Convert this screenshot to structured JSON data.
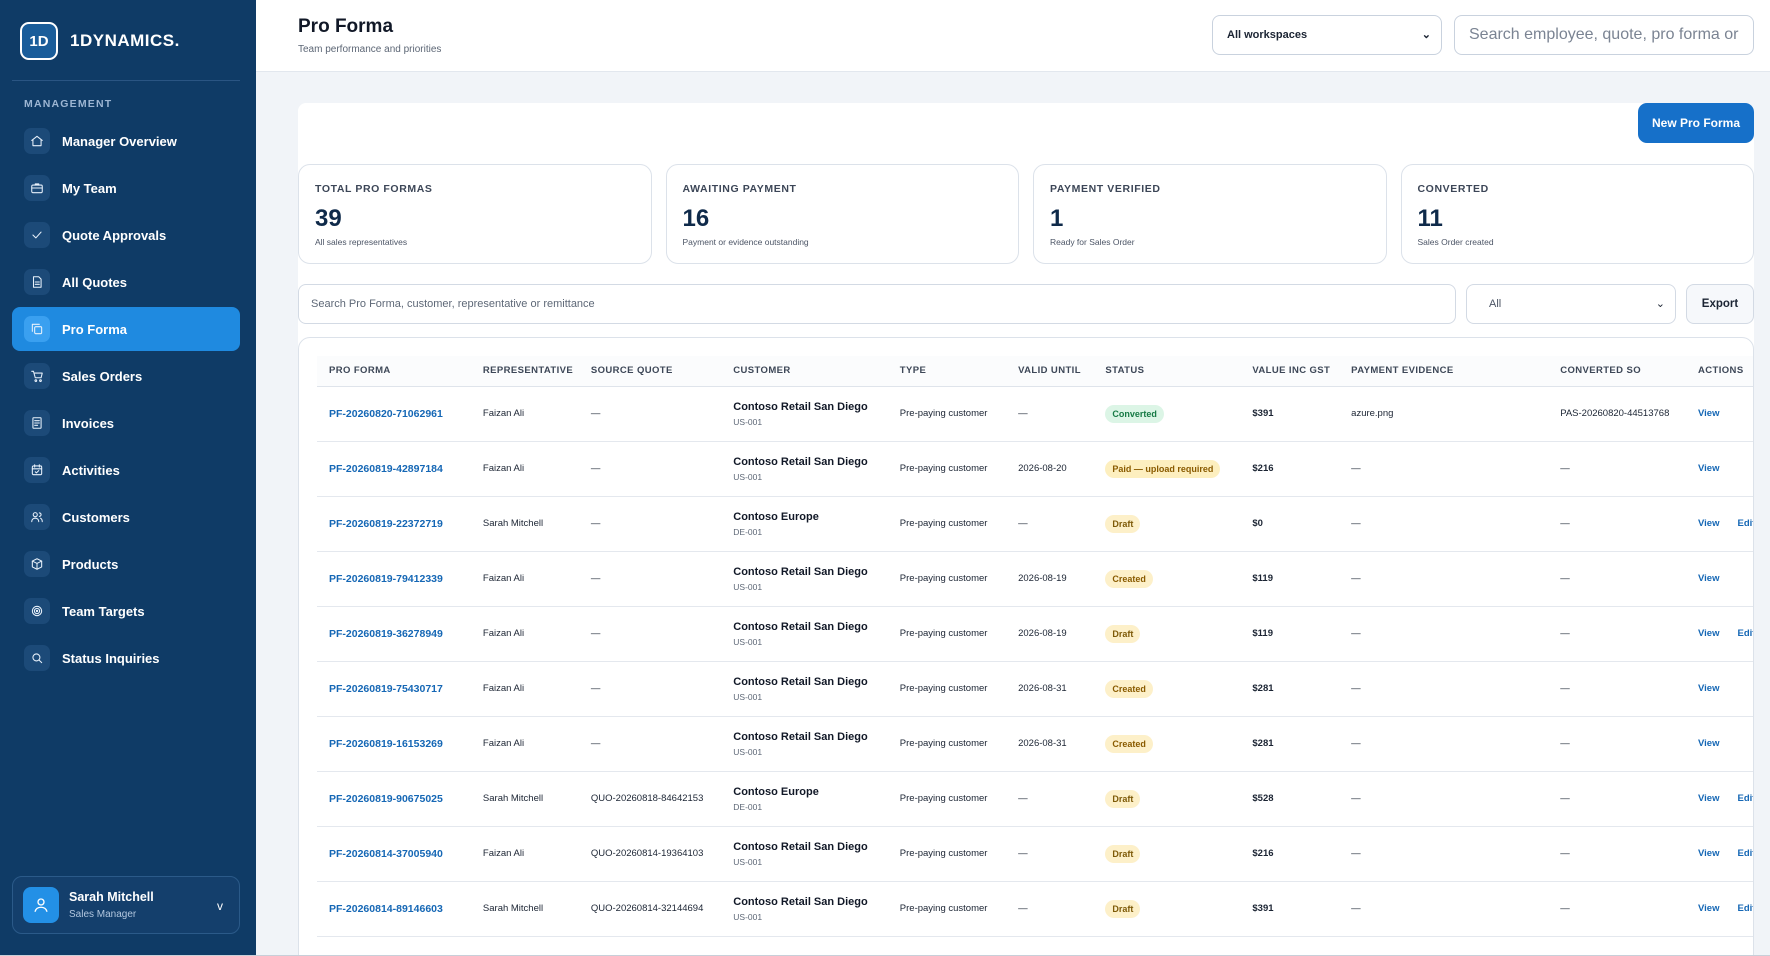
{
  "brand": {
    "mark": "1D",
    "name": "1DYNAMICS."
  },
  "sidebar": {
    "section": "MANAGEMENT",
    "items": [
      {
        "label": "Manager Overview",
        "icon": "home-icon",
        "active": false
      },
      {
        "label": "My Team",
        "icon": "briefcase-icon",
        "active": false
      },
      {
        "label": "Quote Approvals",
        "icon": "check-icon",
        "active": false
      },
      {
        "label": "All Quotes",
        "icon": "document-icon",
        "active": false
      },
      {
        "label": "Pro Forma",
        "icon": "copy-icon",
        "active": true
      },
      {
        "label": "Sales Orders",
        "icon": "cart-icon",
        "active": false
      },
      {
        "label": "Invoices",
        "icon": "invoice-icon",
        "active": false
      },
      {
        "label": "Activities",
        "icon": "calendar-icon",
        "active": false
      },
      {
        "label": "Customers",
        "icon": "users-icon",
        "active": false
      },
      {
        "label": "Products",
        "icon": "box-icon",
        "active": false
      },
      {
        "label": "Team Targets",
        "icon": "target-icon",
        "active": false
      },
      {
        "label": "Status Inquiries",
        "icon": "search-icon",
        "active": false
      }
    ]
  },
  "user": {
    "name": "Sarah Mitchell",
    "role": "Sales Manager",
    "chevron": "v"
  },
  "header": {
    "title": "Pro Forma",
    "subtitle": "Team performance and priorities",
    "workspace": "All workspaces",
    "search_placeholder": "Search employee, quote, pro forma or"
  },
  "actions": {
    "new_label": "New Pro Forma",
    "export_label": "Export"
  },
  "kpis": [
    {
      "label": "TOTAL PRO FORMAS",
      "value": "39",
      "sub": "All sales representatives"
    },
    {
      "label": "AWAITING PAYMENT",
      "value": "16",
      "sub": "Payment or evidence outstanding"
    },
    {
      "label": "PAYMENT VERIFIED",
      "value": "1",
      "sub": "Ready for Sales Order"
    },
    {
      "label": "CONVERTED",
      "value": "11",
      "sub": "Sales Order created"
    }
  ],
  "filters": {
    "search_placeholder": "Search Pro Forma, customer, representative or remittance",
    "status_value": "All"
  },
  "table": {
    "columns": [
      "PRO FORMA",
      "REPRESENTATIVE",
      "SOURCE QUOTE",
      "CUSTOMER",
      "TYPE",
      "VALID UNTIL",
      "STATUS",
      "VALUE INC GST",
      "PAYMENT EVIDENCE",
      "CONVERTED SO",
      "ACTIONS"
    ],
    "rows": [
      {
        "pf": "PF-20260820-71062961",
        "rep": "Faizan Ali",
        "quote": "—",
        "customer": "Contoso Retail San Diego",
        "code": "US-001",
        "type": "Pre-paying customer",
        "valid": "—",
        "status": "Converted",
        "status_kind": "converted",
        "value": "$391",
        "evidence": "azure.png",
        "so": "PAS-20260820-44513768",
        "view": "View",
        "edit": ""
      },
      {
        "pf": "PF-20260819-42897184",
        "rep": "Faizan Ali",
        "quote": "—",
        "customer": "Contoso Retail San Diego",
        "code": "US-001",
        "type": "Pre-paying customer",
        "valid": "2026-08-20",
        "status": "Paid — upload required",
        "status_kind": "paid",
        "value": "$216",
        "evidence": "—",
        "so": "—",
        "view": "View",
        "edit": ""
      },
      {
        "pf": "PF-20260819-22372719",
        "rep": "Sarah Mitchell",
        "quote": "—",
        "customer": "Contoso Europe",
        "code": "DE-001",
        "type": "Pre-paying customer",
        "valid": "—",
        "status": "Draft",
        "status_kind": "draft",
        "value": "$0",
        "evidence": "—",
        "so": "—",
        "view": "View",
        "edit": "Edit"
      },
      {
        "pf": "PF-20260819-79412339",
        "rep": "Faizan Ali",
        "quote": "—",
        "customer": "Contoso Retail San Diego",
        "code": "US-001",
        "type": "Pre-paying customer",
        "valid": "2026-08-19",
        "status": "Created",
        "status_kind": "created",
        "value": "$119",
        "evidence": "—",
        "so": "—",
        "view": "View",
        "edit": ""
      },
      {
        "pf": "PF-20260819-36278949",
        "rep": "Faizan Ali",
        "quote": "—",
        "customer": "Contoso Retail San Diego",
        "code": "US-001",
        "type": "Pre-paying customer",
        "valid": "2026-08-19",
        "status": "Draft",
        "status_kind": "draft",
        "value": "$119",
        "evidence": "—",
        "so": "—",
        "view": "View",
        "edit": "Edit"
      },
      {
        "pf": "PF-20260819-75430717",
        "rep": "Faizan Ali",
        "quote": "—",
        "customer": "Contoso Retail San Diego",
        "code": "US-001",
        "type": "Pre-paying customer",
        "valid": "2026-08-31",
        "status": "Created",
        "status_kind": "created",
        "value": "$281",
        "evidence": "—",
        "so": "—",
        "view": "View",
        "edit": ""
      },
      {
        "pf": "PF-20260819-16153269",
        "rep": "Faizan Ali",
        "quote": "—",
        "customer": "Contoso Retail San Diego",
        "code": "US-001",
        "type": "Pre-paying customer",
        "valid": "2026-08-31",
        "status": "Created",
        "status_kind": "created",
        "value": "$281",
        "evidence": "—",
        "so": "—",
        "view": "View",
        "edit": ""
      },
      {
        "pf": "PF-20260819-90675025",
        "rep": "Sarah Mitchell",
        "quote": "QUO-20260818-84642153",
        "customer": "Contoso Europe",
        "code": "DE-001",
        "type": "Pre-paying customer",
        "valid": "—",
        "status": "Draft",
        "status_kind": "draft",
        "value": "$528",
        "evidence": "—",
        "so": "—",
        "view": "View",
        "edit": "Edit"
      },
      {
        "pf": "PF-20260814-37005940",
        "rep": "Faizan Ali",
        "quote": "QUO-20260814-19364103",
        "customer": "Contoso Retail San Diego",
        "code": "US-001",
        "type": "Pre-paying customer",
        "valid": "—",
        "status": "Draft",
        "status_kind": "draft",
        "value": "$216",
        "evidence": "—",
        "so": "—",
        "view": "View",
        "edit": "Edit"
      },
      {
        "pf": "PF-20260814-89146603",
        "rep": "Sarah Mitchell",
        "quote": "QUO-20260814-32144694",
        "customer": "Contoso Retail San Diego",
        "code": "US-001",
        "type": "Pre-paying customer",
        "valid": "—",
        "status": "Draft",
        "status_kind": "draft",
        "value": "$391",
        "evidence": "—",
        "so": "—",
        "view": "View",
        "edit": "Edit"
      }
    ]
  },
  "colors": {
    "sidebar": "#0f3b66",
    "accent": "#1f8ae0",
    "link": "#1567b5",
    "primary_button": "#1670c9"
  }
}
